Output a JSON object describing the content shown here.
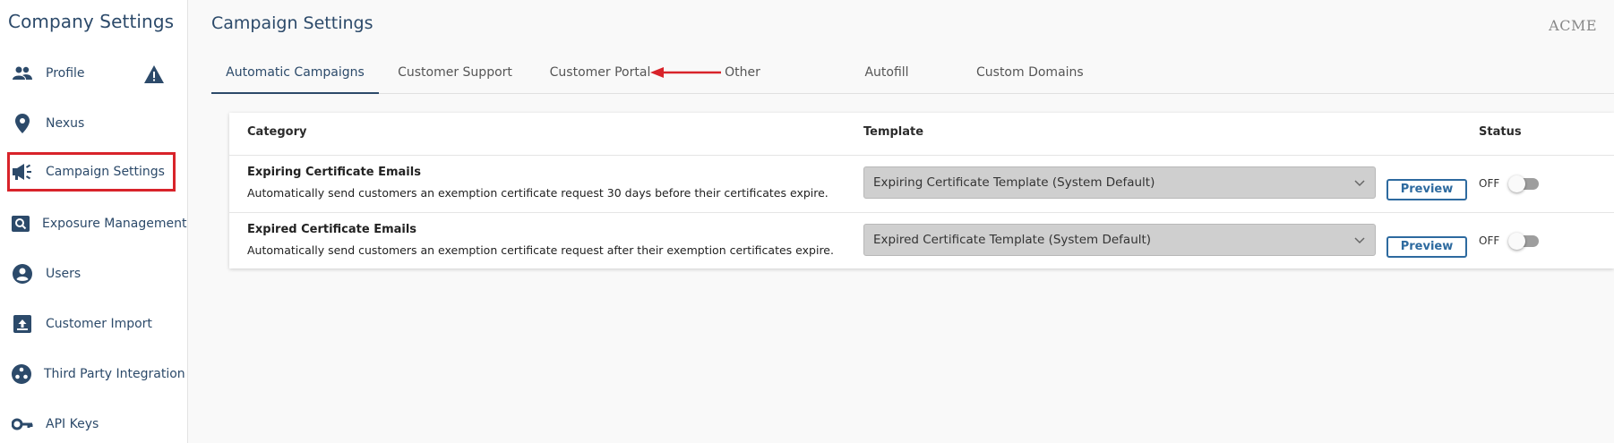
{
  "sidebar": {
    "title": "Company Settings",
    "items": [
      {
        "label": "Profile",
        "icon": "people-icon"
      },
      {
        "label": "Nexus",
        "icon": "location-pin-icon"
      },
      {
        "label": "Campaign Settings",
        "icon": "megaphone-icon"
      },
      {
        "label": "Exposure Management",
        "icon": "search-box-icon"
      },
      {
        "label": "Users",
        "icon": "account-circle-icon"
      },
      {
        "label": "Customer Import",
        "icon": "upload-box-icon"
      },
      {
        "label": "Third Party Integration",
        "icon": "hub-icon"
      },
      {
        "label": "API Keys",
        "icon": "key-icon"
      }
    ],
    "active_item": "Campaign Settings",
    "warning_icon": "warning-triangle-icon"
  },
  "header": {
    "title": "Campaign Settings",
    "brand": "ACME"
  },
  "tabs": [
    {
      "label": "Automatic Campaigns",
      "active": true
    },
    {
      "label": "Customer Support",
      "active": false
    },
    {
      "label": "Customer Portal",
      "active": false
    },
    {
      "label": "Other",
      "active": false
    },
    {
      "label": "Autofill",
      "active": false
    },
    {
      "label": "Custom Domains",
      "active": false
    }
  ],
  "table": {
    "headers": {
      "category": "Category",
      "template": "Template",
      "status": "Status"
    },
    "rows": [
      {
        "title": "Expiring Certificate Emails",
        "description": "Automatically send customers an exemption certificate request 30 days before their certificates expire.",
        "template": "Expiring Certificate Template (System Default)",
        "preview": "Preview",
        "status": "OFF"
      },
      {
        "title": "Expired Certificate Emails",
        "description": "Automatically send customers an exemption certificate request after their exemption certificates expire.",
        "template": "Expired Certificate Template (System Default)",
        "preview": "Preview",
        "status": "OFF"
      }
    ]
  },
  "colors": {
    "primary": "#2c4a6a",
    "highlight": "#d8232a",
    "button": "#2d6a9f"
  }
}
